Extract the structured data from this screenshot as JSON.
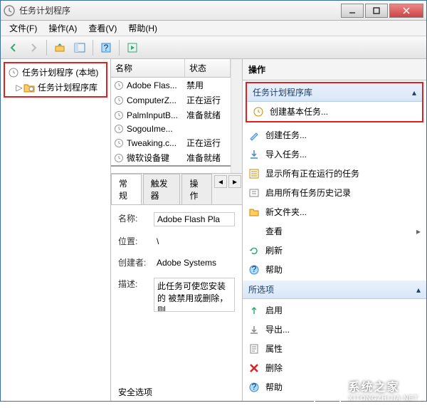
{
  "window": {
    "title": "任务计划程序"
  },
  "menu": {
    "file": "文件(F)",
    "action": "操作(A)",
    "view": "查看(V)",
    "help": "帮助(H)"
  },
  "tree": {
    "root": "任务计划程序 (本地)",
    "library": "任务计划程序库"
  },
  "list": {
    "columns": {
      "name": "名称",
      "status": "状态"
    },
    "rows": [
      {
        "name": "Adobe Flas...",
        "status": "禁用"
      },
      {
        "name": "ComputerZ...",
        "status": "正在运行"
      },
      {
        "name": "PalmInputB...",
        "status": "准备就绪"
      },
      {
        "name": "SogouIme...",
        "status": ""
      },
      {
        "name": "Tweaking.c...",
        "status": "正在运行"
      },
      {
        "name": "微软设备键",
        "status": "准备就绪"
      }
    ]
  },
  "tabs": {
    "general": "常规",
    "triggers": "触发器",
    "actions": "操作"
  },
  "detail": {
    "nameLabel": "名称:",
    "nameValue": "Adobe Flash Pla",
    "locationLabel": "位置:",
    "locationValue": "\\",
    "authorLabel": "创建者:",
    "authorValue": "Adobe Systems",
    "descLabel": "描述:",
    "descValue": "此任务可使您安装的 被禁用或删除，则",
    "securityOptions": "安全选项"
  },
  "actions": {
    "header": "操作",
    "group1": "任务计划程序库",
    "group2": "所选项",
    "items1": [
      {
        "key": "create-basic",
        "label": "创建基本任务...",
        "icon": "clock"
      },
      {
        "key": "create-task",
        "label": "创建任务...",
        "icon": "wand"
      },
      {
        "key": "import",
        "label": "导入任务...",
        "icon": "import"
      },
      {
        "key": "show-running",
        "label": "显示所有正在运行的任务",
        "icon": "list"
      },
      {
        "key": "enable-history",
        "label": "启用所有任务历史记录",
        "icon": "history"
      },
      {
        "key": "new-folder",
        "label": "新文件夹...",
        "icon": "folder"
      },
      {
        "key": "view",
        "label": "查看",
        "icon": "none",
        "chevron": true
      },
      {
        "key": "refresh",
        "label": "刷新",
        "icon": "refresh"
      },
      {
        "key": "help1",
        "label": "帮助",
        "icon": "help"
      }
    ],
    "items2": [
      {
        "key": "enable",
        "label": "启用",
        "icon": "enable"
      },
      {
        "key": "export",
        "label": "导出...",
        "icon": "export"
      },
      {
        "key": "properties",
        "label": "属性",
        "icon": "props"
      },
      {
        "key": "delete",
        "label": "删除",
        "icon": "delete"
      },
      {
        "key": "help2",
        "label": "帮助",
        "icon": "help"
      }
    ]
  },
  "watermark": {
    "name": "系统之家",
    "url": "XITONGZHIJIA.NET"
  }
}
